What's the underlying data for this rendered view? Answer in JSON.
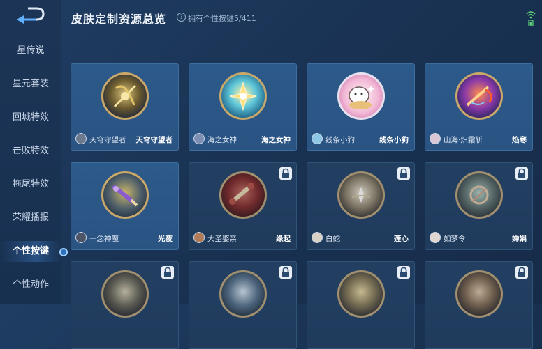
{
  "header": {
    "title": "皮肤定制资源总览",
    "help_icon": "?",
    "owned_text": "拥有个性按键5/411"
  },
  "sidebar": {
    "items": [
      {
        "label": "星传说"
      },
      {
        "label": "星元套装"
      },
      {
        "label": "回城特效"
      },
      {
        "label": "击败特效"
      },
      {
        "label": "拖尾特效"
      },
      {
        "label": "荣耀播报"
      },
      {
        "label": "个性按键",
        "active": true
      },
      {
        "label": "个性动作"
      }
    ]
  },
  "cards": [
    {
      "owner": "天穹守望者",
      "skin": "天穹守望者",
      "locked": false,
      "icon": "golden-bow-icon"
    },
    {
      "owner": "海之女神",
      "skin": "海之女神",
      "locked": false,
      "icon": "lotus-flower-icon"
    },
    {
      "owner": "线条小狗",
      "skin": "线条小狗",
      "locked": false,
      "icon": "line-puppy-icon"
    },
    {
      "owner": "山海·炽霜斩",
      "skin": "焰寒",
      "locked": false,
      "icon": "flame-blade-icon"
    },
    {
      "owner": "一念神魔",
      "skin": "光夜",
      "locked": false,
      "icon": "purple-weapon-icon"
    },
    {
      "owner": "大圣娶亲",
      "skin": "缘起",
      "locked": true,
      "icon": "red-scroll-icon"
    },
    {
      "owner": "白蛇",
      "skin": "莲心",
      "locked": true,
      "icon": "white-lotus-icon"
    },
    {
      "owner": "如梦令",
      "skin": "婵娟",
      "locked": true,
      "icon": "moon-sigil-icon"
    },
    {
      "owner": "",
      "skin": "",
      "locked": true,
      "icon": "bow-icon"
    },
    {
      "owner": "",
      "skin": "",
      "locked": true,
      "icon": "feather-icon"
    },
    {
      "owner": "",
      "skin": "",
      "locked": true,
      "icon": "gold-orb-icon"
    },
    {
      "owner": "",
      "skin": "",
      "locked": true,
      "icon": "beast-icon"
    }
  ],
  "colors": {
    "background": "#1a3354",
    "card": "#2c5a8a",
    "card_locked": "#223f62",
    "orb_ring": "#c9a86a",
    "active_indicator": "#2d6fb8"
  }
}
